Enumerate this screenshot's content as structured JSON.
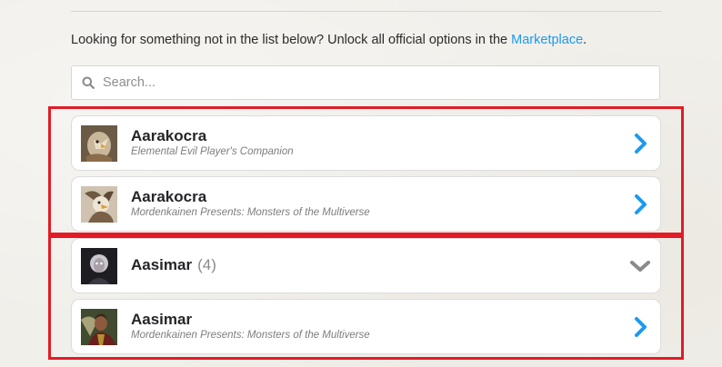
{
  "intro": {
    "text": "Looking for something not in the list below? Unlock all official options in the ",
    "link": "Marketplace",
    "suffix": "."
  },
  "search": {
    "placeholder": "Search...",
    "icon": "search-icon"
  },
  "colors": {
    "accent": "#1b9af0",
    "highlight": "#e21b26",
    "chevron_muted": "#8a8a8a"
  },
  "races": [
    {
      "name": "Aarakocra",
      "source": "Elemental Evil Player's Companion",
      "action_icon": "chevron-right-icon"
    },
    {
      "name": "Aarakocra",
      "source": "Mordenkainen Presents: Monsters of the Multiverse",
      "action_icon": "chevron-right-icon"
    },
    {
      "name": "Aasimar",
      "count": "(4)",
      "action_icon": "chevron-down-icon"
    },
    {
      "name": "Aasimar",
      "source": "Mordenkainen Presents: Monsters of the Multiverse",
      "action_icon": "chevron-right-icon"
    }
  ]
}
